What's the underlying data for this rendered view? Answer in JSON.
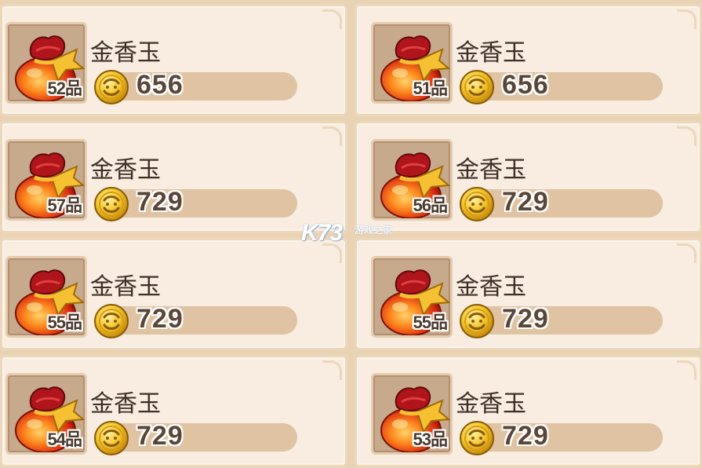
{
  "shop": {
    "items": [
      {
        "name": "金香玉",
        "grade": "52品",
        "price": "656"
      },
      {
        "name": "金香玉",
        "grade": "51品",
        "price": "656"
      },
      {
        "name": "金香玉",
        "grade": "57品",
        "price": "729"
      },
      {
        "name": "金香玉",
        "grade": "56品",
        "price": "729"
      },
      {
        "name": "金香玉",
        "grade": "55品",
        "price": "729"
      },
      {
        "name": "金香玉",
        "grade": "55品",
        "price": "729"
      },
      {
        "name": "金香玉",
        "grade": "54品",
        "price": "729"
      },
      {
        "name": "金香玉",
        "grade": "53品",
        "price": "729"
      }
    ]
  },
  "watermark": {
    "logo": "K73",
    "tagline": "游戏之家"
  },
  "icons": {
    "item": "red-pouch-icon",
    "currency": "gold-coin-icon"
  },
  "colors": {
    "card_bg": "#f8ede0",
    "price_bar": "#dfc3a2",
    "slot_bg": "#c7a98c"
  }
}
